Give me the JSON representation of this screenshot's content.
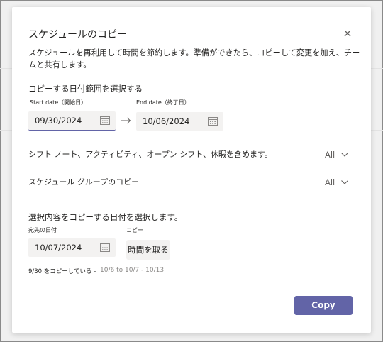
{
  "dialog": {
    "title": "スケジュールのコピー",
    "description": "スケジュールを再利用して時間を節約します。準備ができたら、コピーして変更を加え、チームと共有します。"
  },
  "date_range": {
    "heading": "コピーする日付範囲を選択する",
    "start_label": "Start date（開始日）",
    "start_value": "09/30/2024",
    "end_label": "End date（終了日）",
    "end_value": "10/06/2024"
  },
  "options": {
    "include_label": "シフト ノート、アクティビティ、オープン シフト、休暇を含めます。",
    "include_value": "All",
    "groups_label": "スケジュール グループのコピー",
    "groups_value": "All"
  },
  "destination": {
    "heading": "選択内容をコピーする日付を選択します。",
    "date_label": "宛先の日付",
    "date_value": "10/07/2024",
    "copy_label": "コピー",
    "copy_button": "時間を取る"
  },
  "summary": {
    "note": "9/30 をコピーしている -",
    "range": "10/6 to 10/7 - 10/13."
  },
  "footer": {
    "copy_button": "Copy"
  },
  "colors": {
    "accent": "#6264a7",
    "field_bg": "#f3f2f1"
  }
}
